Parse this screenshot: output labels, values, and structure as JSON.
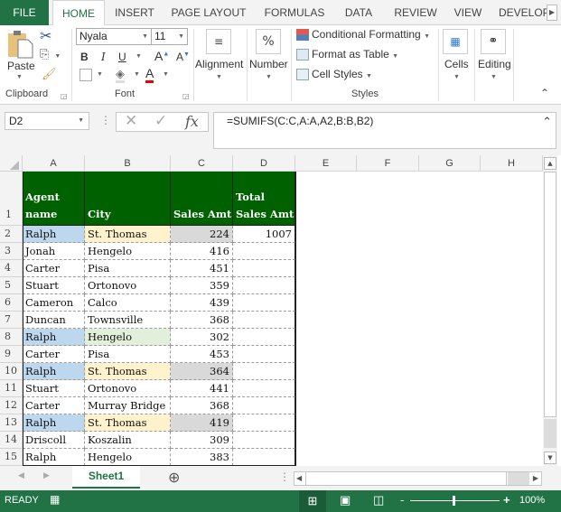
{
  "ribbon_tabs": [
    "FILE",
    "HOME",
    "INSERT",
    "PAGE LAYOUT",
    "FORMULAS",
    "DATA",
    "REVIEW",
    "VIEW",
    "DEVELOP"
  ],
  "active_tab": "HOME",
  "ribbon": {
    "clipboard": {
      "paste_label": "Paste",
      "group_label": "Clipboard"
    },
    "font": {
      "font_name": "Nyala",
      "font_size": "11",
      "bold": "B",
      "italic": "I",
      "underline": "U",
      "grow": "A",
      "shrink": "A",
      "font_color": "A",
      "group_label": "Font"
    },
    "alignment": {
      "label": "Alignment",
      "icon": "≡"
    },
    "number": {
      "label": "Number",
      "icon": "%"
    },
    "styles": {
      "conditional_formatting": "Conditional Formatting",
      "format_as_table": "Format as Table",
      "cell_styles": "Cell Styles",
      "group_label": "Styles"
    },
    "cells": {
      "label": "Cells"
    },
    "editing": {
      "label": "Editing"
    }
  },
  "formula_bar": {
    "name_box": "D2",
    "cancel_icon": "✕",
    "enter_icon": "✓",
    "fx_icon": "fx",
    "formula": "=SUMIFS(C:C,A:A,A2,B:B,B2)"
  },
  "columns": [
    "A",
    "B",
    "C",
    "D",
    "E",
    "F",
    "G",
    "H"
  ],
  "header_row": {
    "row_num": "1",
    "cells": [
      [
        "Agent",
        "name"
      ],
      [
        "",
        "City"
      ],
      [
        "",
        "Sales Amt"
      ],
      [
        "Total",
        "Sales Amt"
      ]
    ]
  },
  "rows": [
    {
      "num": "2",
      "agent": "Ralph",
      "city": "St. Thomas",
      "sales": "224",
      "total": "1007",
      "hl": "match"
    },
    {
      "num": "3",
      "agent": "Jonah",
      "city": "Hengelo",
      "sales": "416",
      "total": "",
      "hl": ""
    },
    {
      "num": "4",
      "agent": "Carter",
      "city": "Pisa",
      "sales": "451",
      "total": "",
      "hl": ""
    },
    {
      "num": "5",
      "agent": "Stuart",
      "city": "Ortonovo",
      "sales": "359",
      "total": "",
      "hl": ""
    },
    {
      "num": "6",
      "agent": "Cameron",
      "city": "Calco",
      "sales": "439",
      "total": "",
      "hl": ""
    },
    {
      "num": "7",
      "agent": "Duncan",
      "city": "Townsville",
      "sales": "368",
      "total": "",
      "hl": ""
    },
    {
      "num": "8",
      "agent": "Ralph",
      "city": "Hengelo",
      "sales": "302",
      "total": "",
      "hl": "agent-only"
    },
    {
      "num": "9",
      "agent": "Carter",
      "city": "Pisa",
      "sales": "453",
      "total": "",
      "hl": ""
    },
    {
      "num": "10",
      "agent": "Ralph",
      "city": "St. Thomas",
      "sales": "364",
      "total": "",
      "hl": "match"
    },
    {
      "num": "11",
      "agent": "Stuart",
      "city": "Ortonovo",
      "sales": "441",
      "total": "",
      "hl": ""
    },
    {
      "num": "12",
      "agent": "Carter",
      "city": "Murray Bridge",
      "sales": "368",
      "total": "",
      "hl": ""
    },
    {
      "num": "13",
      "agent": "Ralph",
      "city": "St. Thomas",
      "sales": "419",
      "total": "",
      "hl": "match"
    },
    {
      "num": "14",
      "agent": "Driscoll",
      "city": "Koszalin",
      "sales": "309",
      "total": "",
      "hl": ""
    },
    {
      "num": "15",
      "agent": "Ralph",
      "city": "Hengelo",
      "sales": "383",
      "total": "",
      "hl": ""
    }
  ],
  "colors": {
    "excel_green": "#217346",
    "header_fill": "#006100",
    "agent_highlight": "#bdd7ee",
    "city_highlight": "#fff2cc",
    "city_alt_highlight": "#e2efda",
    "sales_highlight": "#d9d9d9"
  },
  "sheet_tabs": [
    "Sheet1"
  ],
  "add_sheet_icon": "⊕",
  "status": {
    "ready": "READY",
    "zoom": "100%",
    "zoom_level_percent": 100
  }
}
